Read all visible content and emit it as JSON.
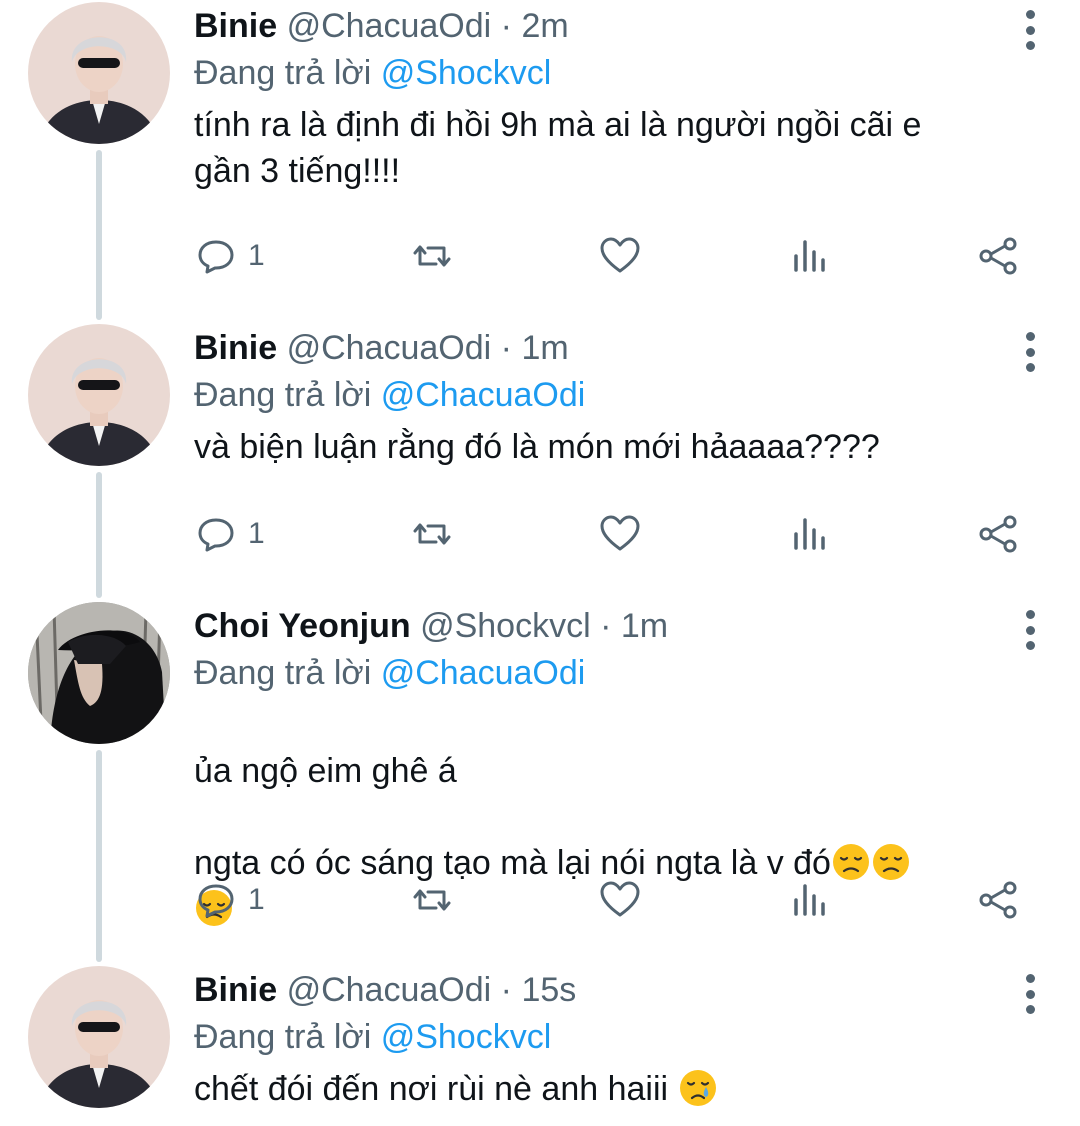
{
  "colors": {
    "accent": "#1d9bf0",
    "muted": "#536471",
    "text": "#0f1419",
    "thread_line": "#cfd9de"
  },
  "tweets": [
    {
      "name": "Binie",
      "handle": "@ChacuaOdi",
      "dot": "·",
      "time": "2m",
      "reply_prefix": "Đang trả lời ",
      "reply_to": "@Shockvcl",
      "text": "tính ra là định đi hồi 9h mà ai là người ngồi cãi e\ngần 3 tiếng!!!!",
      "reply_count": "1",
      "avatar": "avatar-binie"
    },
    {
      "name": "Binie",
      "handle": "@ChacuaOdi",
      "dot": "·",
      "time": "1m",
      "reply_prefix": "Đang trả lời ",
      "reply_to": "@ChacuaOdi",
      "text": "và biện luận rằng đó là món mới hảaaaa????",
      "reply_count": "1",
      "avatar": "avatar-binie"
    },
    {
      "name": "Choi Yeonjun",
      "handle": "@Shockvcl",
      "dot": "·",
      "time": "1m",
      "reply_prefix": "Đang trả lời ",
      "reply_to": "@ChacuaOdi",
      "text_line1": "ủa ngộ eim ghê á",
      "text_line2": "ngta có óc sáng tạo mà lại nói ngta là v đó",
      "emoji": "disappointed-face",
      "reply_count": "1",
      "avatar": "avatar-yeonjun"
    },
    {
      "name": "Binie",
      "handle": "@ChacuaOdi",
      "dot": "·",
      "time": "15s",
      "reply_prefix": "Đang trả lời ",
      "reply_to": "@Shockvcl",
      "text": "chết đói đến nơi rùi nè anh haiii ",
      "emoji": "crying-face",
      "avatar": "avatar-binie"
    }
  ]
}
